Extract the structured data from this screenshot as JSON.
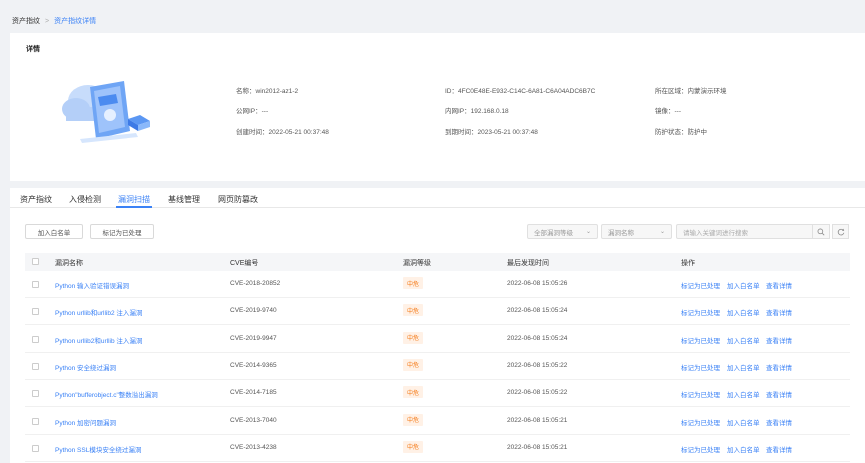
{
  "breadcrumb": {
    "root": "资产指纹",
    "separator": ">",
    "current": "资产指纹详情"
  },
  "detail": {
    "title": "详情",
    "name": "名称：win2012-az1-2",
    "id": "ID：4FC0E48E-E932-C14C-6A81-C6A04ADC6B7C",
    "region": "所在区域：内蒙演示环境",
    "public_ip": "公网IP：---",
    "private_ip": "内网IP：192.168.0.18",
    "image": "镜像：---",
    "created": "创建时间：2022-05-21 00:37:48",
    "expires": "到期时间：2023-05-21 00:37:48",
    "protection": "防护状态：防护中"
  },
  "tabs": [
    "资产指纹",
    "入侵检测",
    "漏洞扫描",
    "基线管理",
    "网页防篡改"
  ],
  "toolbar": {
    "whitelist_label": "加入白名单",
    "mark_handled_label": "标记为已处理",
    "level_select": "全部漏洞等级",
    "field_select": "漏洞名称",
    "search_placeholder": "请输入关键词进行搜索"
  },
  "table": {
    "headers": [
      "漏洞名称",
      "CVE编号",
      "漏洞等级",
      "最后发现时间",
      "操作"
    ],
    "rows": [
      {
        "name": "Python 输入验证错误漏洞",
        "cve": "CVE-2018-20852",
        "level": "中危",
        "time": "2022-06-08 15:05:26"
      },
      {
        "name": "Python urllib和urllib2 注入漏洞",
        "cve": "CVE-2019-9740",
        "level": "中危",
        "time": "2022-06-08 15:05:24"
      },
      {
        "name": "Python urllib2和urllib 注入漏洞",
        "cve": "CVE-2019-9947",
        "level": "中危",
        "time": "2022-06-08 15:05:24"
      },
      {
        "name": "Python 安全绕过漏洞",
        "cve": "CVE-2014-9365",
        "level": "中危",
        "time": "2022-06-08 15:05:22"
      },
      {
        "name": "Python\"bufferobject.c\"整数溢出漏洞",
        "cve": "CVE-2014-7185",
        "level": "中危",
        "time": "2022-06-08 15:05:22"
      },
      {
        "name": "Python 加密问题漏洞",
        "cve": "CVE-2013-7040",
        "level": "中危",
        "time": "2022-06-08 15:05:21"
      },
      {
        "name": "Python SSL模块安全绕过漏洞",
        "cve": "CVE-2013-4238",
        "level": "中危",
        "time": "2022-06-08 15:05:21"
      }
    ],
    "actions": [
      "标记为已处理",
      "加入白名单",
      "查看详情"
    ]
  },
  "colors": {
    "accent": "#3b82f6",
    "badge_bg": "#fff1e6",
    "badge_text": "#f57a17"
  }
}
